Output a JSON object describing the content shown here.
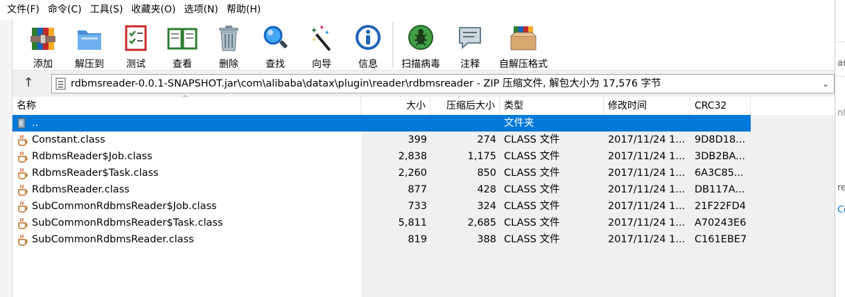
{
  "menu": [
    "文件(F)",
    "命令(C)",
    "工具(S)",
    "收藏夹(O)",
    "选项(N)",
    "帮助(H)"
  ],
  "toolbar": {
    "add": "添加",
    "extract": "解压到",
    "test": "测试",
    "view": "查看",
    "delete": "删除",
    "find": "查找",
    "wizard": "向导",
    "info": "信息",
    "virus_scan": "扫描病毒",
    "comment": "注释",
    "sfx": "自解压格式"
  },
  "address": {
    "path": "rdbmsreader-0.0.1-SNAPSHOT.jar\\com\\alibaba\\datax\\plugin\\reader\\rdbmsreader - ZIP 压缩文件, 解包大小为 17,576 字节"
  },
  "columns": {
    "name": "名称",
    "size": "大小",
    "packed": "压缩后大小",
    "type": "类型",
    "modified": "修改时间",
    "crc": "CRC32"
  },
  "parent_row": {
    "name": "..",
    "type": "文件夹"
  },
  "files": [
    {
      "name": "Constant.class",
      "size": "399",
      "packed": "274",
      "type": "CLASS 文件",
      "modified": "2017/11/24 1...",
      "crc": "9D8D18..."
    },
    {
      "name": "RdbmsReader$Job.class",
      "size": "2,838",
      "packed": "1,175",
      "type": "CLASS 文件",
      "modified": "2017/11/24 1...",
      "crc": "3DB2BA..."
    },
    {
      "name": "RdbmsReader$Task.class",
      "size": "2,260",
      "packed": "850",
      "type": "CLASS 文件",
      "modified": "2017/11/24 1...",
      "crc": "6A3C85..."
    },
    {
      "name": "RdbmsReader.class",
      "size": "877",
      "packed": "428",
      "type": "CLASS 文件",
      "modified": "2017/11/24 1...",
      "crc": "DB117A..."
    },
    {
      "name": "SubCommonRdbmsReader$Job.class",
      "size": "733",
      "packed": "324",
      "type": "CLASS 文件",
      "modified": "2017/11/24 1...",
      "crc": "21F22FD4"
    },
    {
      "name": "SubCommonRdbmsReader$Task.class",
      "size": "5,811",
      "packed": "2,685",
      "type": "CLASS 文件",
      "modified": "2017/11/24 1...",
      "crc": "A70243E6"
    },
    {
      "name": "SubCommonRdbmsReader.class",
      "size": "819",
      "packed": "388",
      "type": "CLASS 文件",
      "modified": "2017/11/24 1...",
      "crc": "C161EBE7"
    }
  ],
  "background_fragments": [
    "ar",
    "nts",
    "re",
    "Co"
  ],
  "colors": {
    "selection": "#0078d7",
    "menu_bg": "#ffffff",
    "list_bg": "#ffffff"
  }
}
